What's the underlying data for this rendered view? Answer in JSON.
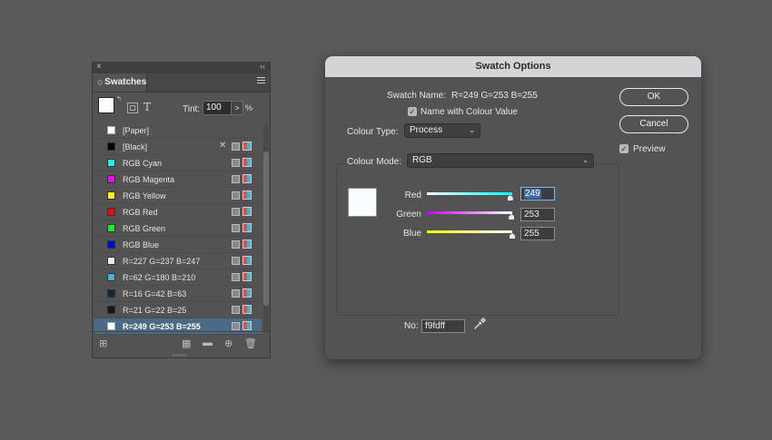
{
  "swatches_panel": {
    "title": "Swatches",
    "tint_label": "Tint:",
    "tint_value": "100",
    "tint_step_glyph": ">",
    "tint_unit": "%",
    "text_mode_glyph": "T",
    "items": [
      {
        "label": "[Paper]",
        "color": "#ffffff",
        "lock": false,
        "mode": false,
        "type": false
      },
      {
        "label": "[Black]",
        "color": "#000000",
        "lock": true,
        "mode": true,
        "type": true
      },
      {
        "label": "RGB Cyan",
        "color": "#00ffff",
        "lock": false,
        "mode": true,
        "type": true
      },
      {
        "label": "RGB Magenta",
        "color": "#ff00ff",
        "lock": false,
        "mode": true,
        "type": true
      },
      {
        "label": "RGB Yellow",
        "color": "#ffff00",
        "lock": false,
        "mode": true,
        "type": true
      },
      {
        "label": "RGB Red",
        "color": "#ff0000",
        "lock": false,
        "mode": true,
        "type": true
      },
      {
        "label": "RGB Green",
        "color": "#00ff00",
        "lock": false,
        "mode": true,
        "type": true
      },
      {
        "label": "RGB Blue",
        "color": "#0000ff",
        "lock": false,
        "mode": true,
        "type": true
      },
      {
        "label": "R=227 G=237 B=247",
        "color": "#e3edf7",
        "lock": false,
        "mode": true,
        "type": true
      },
      {
        "label": "R=62 G=180 B=210",
        "color": "#3eb4d2",
        "lock": false,
        "mode": true,
        "type": true
      },
      {
        "label": "R=16 G=42 B=63",
        "color": "#102a3f",
        "lock": false,
        "mode": true,
        "type": true
      },
      {
        "label": "R=21 G=22 B=25",
        "color": "#151619",
        "lock": false,
        "mode": true,
        "type": true
      },
      {
        "label": "R=249 G=253 B=255",
        "color": "#f9fdff",
        "lock": false,
        "mode": true,
        "type": true,
        "selected": true
      }
    ],
    "bottom_icons": [
      "show-swatch-kinds-icon",
      "new-color-group-icon",
      "folder-icon",
      "new-swatch-icon",
      "trash-icon"
    ]
  },
  "dialog": {
    "title": "Swatch Options",
    "swatch_name_label": "Swatch Name:",
    "swatch_name_value": "R=249 G=253 B=255",
    "name_with_colour_value_label": "Name with Colour Value",
    "name_with_colour_value_checked": true,
    "colour_type_label": "Colour Type:",
    "colour_type_value": "Process",
    "colour_mode_label": "Colour Mode:",
    "colour_mode_value": "RGB",
    "sliders": [
      {
        "label": "Red",
        "value": "249",
        "fraction": 0.976,
        "gradient_from": "#f9fdff",
        "gradient_to": "#00fdff"
      },
      {
        "label": "Green",
        "value": "253",
        "fraction": 0.992,
        "gradient_from": "#c600ff",
        "gradient_to": "#f9fdff"
      },
      {
        "label": "Blue",
        "value": "255",
        "fraction": 1.0,
        "gradient_from": "#f9fd00",
        "gradient_to": "#f9fdff"
      }
    ],
    "preview_color": "#f9fdff",
    "hex_label": "No:",
    "hex_value": "f9fdff",
    "ok_label": "OK",
    "cancel_label": "Cancel",
    "preview_label": "Preview",
    "preview_checked": true
  }
}
